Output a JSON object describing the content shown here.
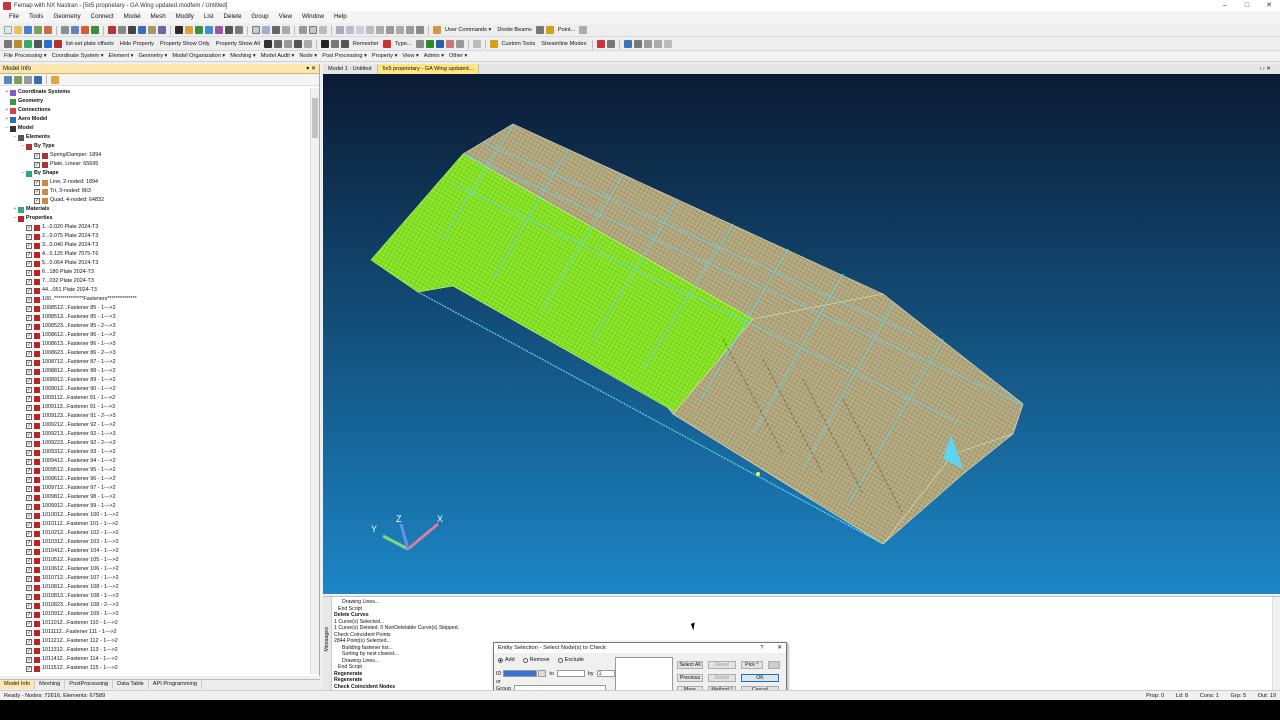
{
  "window": {
    "title": "Femap with NX Nastran - [5x5 proprietary - GA Wing updated.modfem / Untitled]",
    "controls": [
      "–",
      "□",
      "✕"
    ]
  },
  "menu": [
    "File",
    "Tools",
    "Geometry",
    "Connect",
    "Model",
    "Mesh",
    "Modify",
    "List",
    "Delete",
    "Group",
    "View",
    "Window",
    "Help"
  ],
  "toolbar2": {
    "list_set_plate_offsets": "list-set plate offsets",
    "hide_property": "Hide Property",
    "property_show_only": "Property Show Only",
    "property_show_all": "Property Show All",
    "remesher": "Remesher",
    "type": "Type...",
    "custom_tools": "Custom Tools",
    "streamline_modes": "Streamline Modes"
  },
  "toolbar1": {
    "user_commands": "User Commands ▾",
    "divide_beams": "Divide Beams",
    "point": "Point..."
  },
  "dropdowns": [
    "File Processing ▾",
    "Coordinate System ▾",
    "Element ▾",
    "Geometry ▾",
    "Model Organization ▾",
    "Meshing ▾",
    "Model Audit ▾",
    "Node ▾",
    "Post Processing ▾",
    "Property ▾",
    "View ▾",
    "Admin ▾",
    "Other ▾"
  ],
  "panel": {
    "title": "Model Info",
    "tree_top": [
      {
        "label": "Coordinate Systems",
        "bold": true,
        "indent": 0,
        "exp": "+"
      },
      {
        "label": "Geometry",
        "bold": true,
        "indent": 0,
        "exp": ""
      },
      {
        "label": "Connections",
        "bold": true,
        "indent": 0,
        "exp": "+"
      },
      {
        "label": "Aero Model",
        "bold": true,
        "indent": 0,
        "exp": "+"
      },
      {
        "label": "Model",
        "bold": true,
        "indent": 0,
        "exp": "–"
      },
      {
        "label": "Elements",
        "bold": true,
        "indent": 1,
        "exp": "–"
      },
      {
        "label": "By Type",
        "bold": true,
        "indent": 2,
        "exp": "–"
      },
      {
        "label": "Spring/Damper: 1894",
        "bold": false,
        "indent": 3,
        "exp": "",
        "check": true
      },
      {
        "label": "Plate, Linear: 65695",
        "bold": false,
        "indent": 3,
        "exp": "",
        "check": true
      },
      {
        "label": "By Shape",
        "bold": true,
        "indent": 2,
        "exp": "–"
      },
      {
        "label": "Line, 2-noded: 1894",
        "bold": false,
        "indent": 3,
        "exp": "",
        "check": true
      },
      {
        "label": "Tri, 3-noded: 863",
        "bold": false,
        "indent": 3,
        "exp": "",
        "check": true
      },
      {
        "label": "Quad, 4-noded: 64832",
        "bold": false,
        "indent": 3,
        "exp": "",
        "check": true
      },
      {
        "label": "Materials",
        "bold": true,
        "indent": 1,
        "exp": "+"
      },
      {
        "label": "Properties",
        "bold": true,
        "indent": 1,
        "exp": "–"
      }
    ],
    "properties": [
      "1...0.020 Plate 2024-T3",
      "2...0.075 Plate 2024-T3",
      "3...0.040 Plate 2024-T3",
      "4...0.125 Plate 7075-T6",
      "5...0.064 Plate 2024-T3",
      "6...180 Plate 2024-T3",
      "7...032 Plate 2024-T3",
      "44...051 Plate 2024-T3",
      "100..**************Fasteners**************",
      "1008512...Fastener 85 - 1--->2",
      "1008513...Fastener 85 - 1--->3",
      "1008523...Fastener 85 - 2--->3",
      "1008612...Fastener 86 - 1--->2",
      "1008613...Fastener 86 - 1--->3",
      "1008623...Fastener 86 - 2--->3",
      "1008712...Fastener 87 - 1--->2",
      "1008812...Fastener 88 - 1--->2",
      "1008912...Fastener 89 - 1--->2",
      "1009012...Fastener 90 - 1--->2",
      "1009112...Fastener 91 - 1--->2",
      "1009113...Fastener 91 - 1--->3",
      "1009123...Fastener 91 - 2--->3",
      "1009212...Fastener 92 - 1--->2",
      "1009213...Fastener 92 - 1--->3",
      "1009223...Fastener 92 - 2--->3",
      "1009312...Fastener 93 - 1--->2",
      "1009412...Fastener 94 - 1--->2",
      "1009512...Fastener 95 - 1--->2",
      "1009612...Fastener 96 - 1--->2",
      "1009712...Fastener 97 - 1--->2",
      "1009812...Fastener 98 - 1--->2",
      "1009912...Fastener 99 - 1--->2",
      "1010012...Fastener 100 - 1--->2",
      "1010112...Fastener 101 - 1--->2",
      "1010212...Fastener 102 - 1--->2",
      "1010312...Fastener 103 - 1--->2",
      "1010412...Fastener 104 - 1--->2",
      "1010512...Fastener 105 - 1--->2",
      "1010612...Fastener 106 - 1--->2",
      "1010712...Fastener 107 - 1--->2",
      "1010812...Fastener 108 - 1--->2",
      "1010813...Fastener 108 - 1--->3",
      "1010823...Fastener 108 - 2--->3",
      "1010912...Fastener 109 - 1--->2",
      "1011012...Fastener 110 - 1--->2",
      "1011112...Fastener 111 - 1--->2",
      "1011212...Fastener 112 - 1--->2",
      "1011312...Fastener 113 - 1--->2",
      "1011412...Fastener 114 - 1--->2",
      "1011512...Fastener 115 - 1--->2",
      "1011513...Fastener 115 - 1--->3"
    ],
    "tabs": [
      "Model Info",
      "Meshing",
      "PostProcessing",
      "Data Table",
      "API Programming"
    ]
  },
  "view_tabs": [
    "Model 1 : Untitled",
    "5x5 proprietary - GA Wing updated..."
  ],
  "messages": [
    "Drawing Lines...",
    "End Script",
    "Delete Curves",
    "1 Curve(s) Selected...",
    "1 Curve(s) Deleted. 0 NonDeletable Curve(s) Skipped.",
    "Check Coincident Points",
    "2844 Point(s) Selected...",
    "Building fastener list...",
    "Sorting by next closest...",
    "Drawing Lines...",
    "End Script",
    "Regenerate",
    "Regenerate",
    "Check Coincident Nodes"
  ],
  "messages_label": "Messages",
  "status": {
    "left": "Ready - Nodes: 72616, Elements: 67589",
    "right": [
      "Prop: 0",
      "Ld: 8",
      "Cons: 1",
      "Grp: 5",
      "Out: 19"
    ]
  },
  "dialog": {
    "title": "Entity Selection - Select Node(s) to Check",
    "help": "?",
    "close": "✕",
    "modes": [
      "Add",
      "Remove",
      "Exclude"
    ],
    "id_label": "ID",
    "id_value": "",
    "to_label": "to",
    "by_label": "by",
    "by_value": "1",
    "or_label": "or",
    "group_label": "Group",
    "buttons": {
      "select_all": "Select All",
      "reset": "Reset",
      "pick": "Pick ^",
      "previous": "Previous",
      "delete": "Delete",
      "ok": "OK",
      "more": "More",
      "method": "Method ^",
      "cancel": "Cancel"
    }
  },
  "axis_labels": {
    "x": "X",
    "y": "Y",
    "z": "Z"
  },
  "colors": {
    "viewport_top": "#0b1a33",
    "viewport_bottom": "#1c86c6",
    "mesh_tan": "#b8ad82",
    "mesh_green": "#8ee82a",
    "fastener_cyan": "#5fd4f0",
    "panel_header": "#fde7b0"
  }
}
